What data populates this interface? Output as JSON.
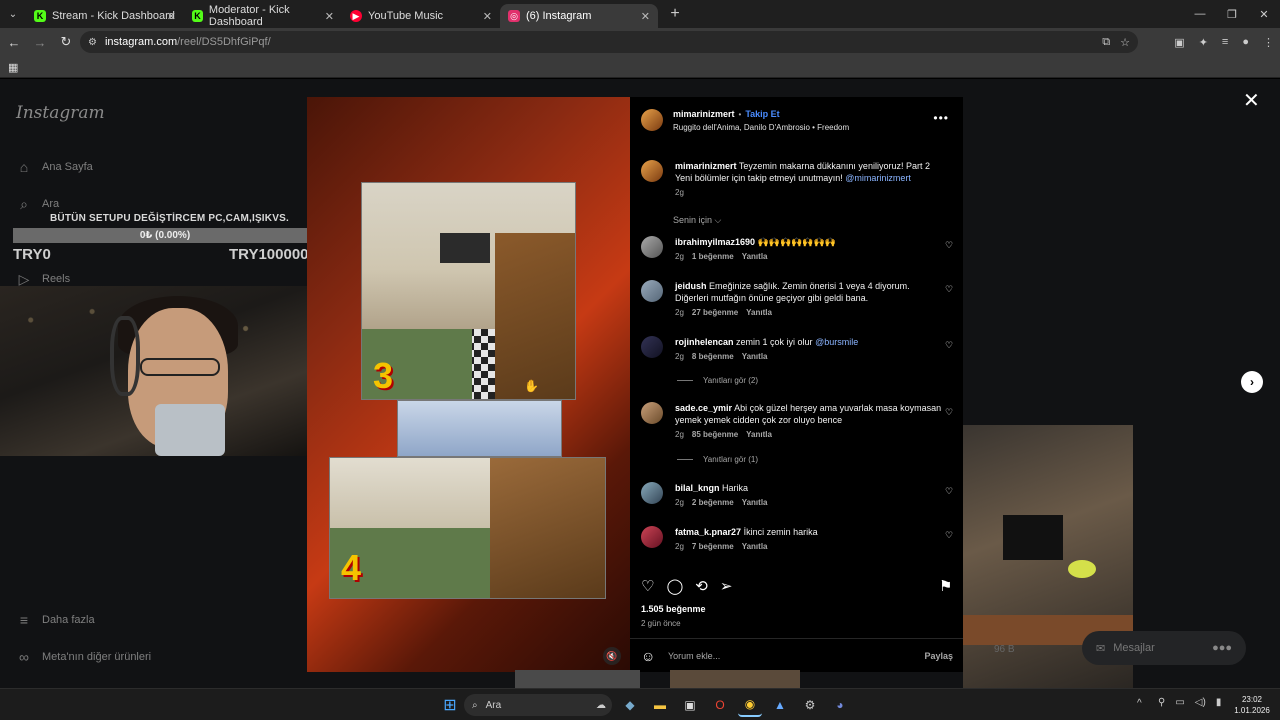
{
  "browser": {
    "tabs": [
      {
        "label": "Stream - Kick Dashboard",
        "icon": "K",
        "icon_color": "#53fc18",
        "active": false
      },
      {
        "label": "Moderator - Kick Dashboard",
        "icon": "K",
        "icon_color": "#53fc18",
        "active": false
      },
      {
        "label": "YouTube Music",
        "icon": "▶",
        "icon_color": "#ff0033",
        "active": false
      },
      {
        "label": "(6) Instagram",
        "icon": "◎",
        "icon_color": "#e1306c",
        "active": true
      }
    ],
    "url_host": "instagram.com",
    "url_path": "/reel/DS5DhfGiPqf/"
  },
  "sidebar": {
    "logo": "Instagram",
    "items": [
      {
        "label": "Ana Sayfa",
        "icon": "home-icon"
      },
      {
        "label": "Ara",
        "icon": "search-icon"
      },
      {
        "label": "Reels",
        "icon": "reels-icon"
      }
    ],
    "bottom_items": [
      {
        "label": "Daha fazla",
        "icon": "menu-icon"
      },
      {
        "label": "Meta'nın diğer ürünleri",
        "icon": "meta-icon"
      }
    ]
  },
  "stream_overlay": {
    "goal_text": "BÜTÜN SETUPU DEĞİŞTİRCEM PC,CAM,IŞIKVS.",
    "progress_text": "0₺ (0.00%)",
    "progress_value": 0,
    "min_label": "TRY0",
    "max_label": "TRY100000"
  },
  "reel": {
    "numbers": [
      "3",
      "4"
    ]
  },
  "post": {
    "author": "mimarinizmert",
    "follow_label": "Takip Et",
    "audio": "Ruggito dell'Anima, Danilo D'Ambrosio • Freedom",
    "caption_user": "mimarinizmert",
    "caption_text": "Teyzemin makarna dükkanını yeniliyoruz! Part 2 Yeni bölümler için takip etmeyi unutmayın!",
    "caption_mention": "@mimarinizmert",
    "caption_time": "2g",
    "sort_label": "Senin için",
    "likes": "1.505 beğenme",
    "posted_ago": "2 gün önce",
    "add_comment_placeholder": "Yorum ekle...",
    "share_label": "Paylaş"
  },
  "comments": [
    {
      "user": "ibrahimyilmaz1690",
      "text": "🙌🙌🙌🙌🙌🙌🙌",
      "mention": "",
      "time": "2g",
      "likes": "1 beğenme",
      "reply": "Yanıtla"
    },
    {
      "user": "jeidush",
      "text": "Emeğinize sağlık. Zemin önerisi 1 veya 4 diyorum. Diğerleri mutfağın önüne geçiyor gibi geldi bana.",
      "mention": "",
      "time": "2g",
      "likes": "27 beğenme",
      "reply": "Yanıtla"
    },
    {
      "user": "rojinhelencan",
      "text": "zemin 1 çok iyi olur",
      "mention": "@bursmile",
      "time": "2g",
      "likes": "8 beğenme",
      "reply": "Yanıtla",
      "view_replies": "Yanıtları gör (2)"
    },
    {
      "user": "sade.ce_ymir",
      "text": "Abi çok güzel herşey ama yuvarlak masa koymasan yemek yemek cidden çok zor oluyo bence",
      "mention": "",
      "time": "2g",
      "likes": "85 beğenme",
      "reply": "Yanıtla",
      "view_replies": "Yanıtları gör (1)"
    },
    {
      "user": "bilal_kngn",
      "text": "Harika",
      "mention": "",
      "time": "2g",
      "likes": "2 beğenme",
      "reply": "Yanıtla"
    },
    {
      "user": "fatma_k.pnar27",
      "text": "İkinci zemin harika",
      "mention": "",
      "time": "2g",
      "likes": "7 beğenme",
      "reply": "Yanıtla"
    }
  ],
  "background": {
    "messages_label": "Mesajlar",
    "views": "96 B"
  },
  "taskbar": {
    "search_label": "Ara",
    "time": "23:02",
    "date": "1.01.2026"
  }
}
